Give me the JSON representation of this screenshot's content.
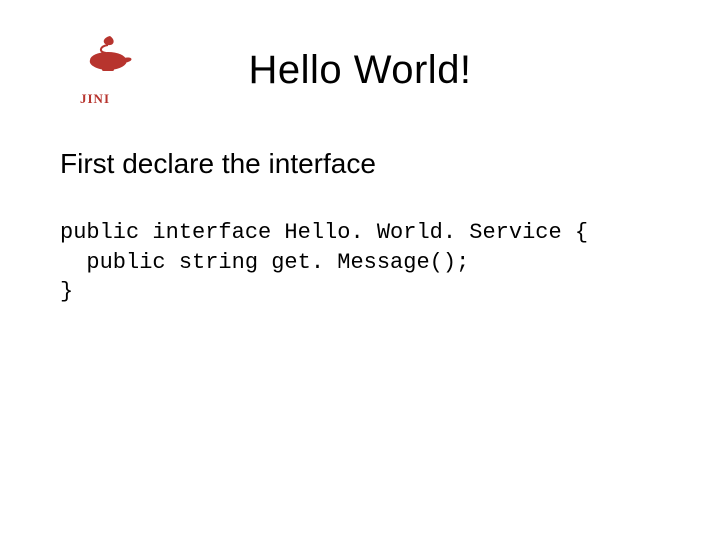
{
  "logo": {
    "name": "jini-logo",
    "text": "JINI",
    "colors": {
      "lamp": "#b7342e",
      "text": "#b7342e"
    }
  },
  "title": "Hello World!",
  "subtitle": "First declare the interface",
  "code": {
    "line1": "public interface Hello. World. Service {",
    "line2": "  public string get. Message();",
    "line3": "}"
  }
}
